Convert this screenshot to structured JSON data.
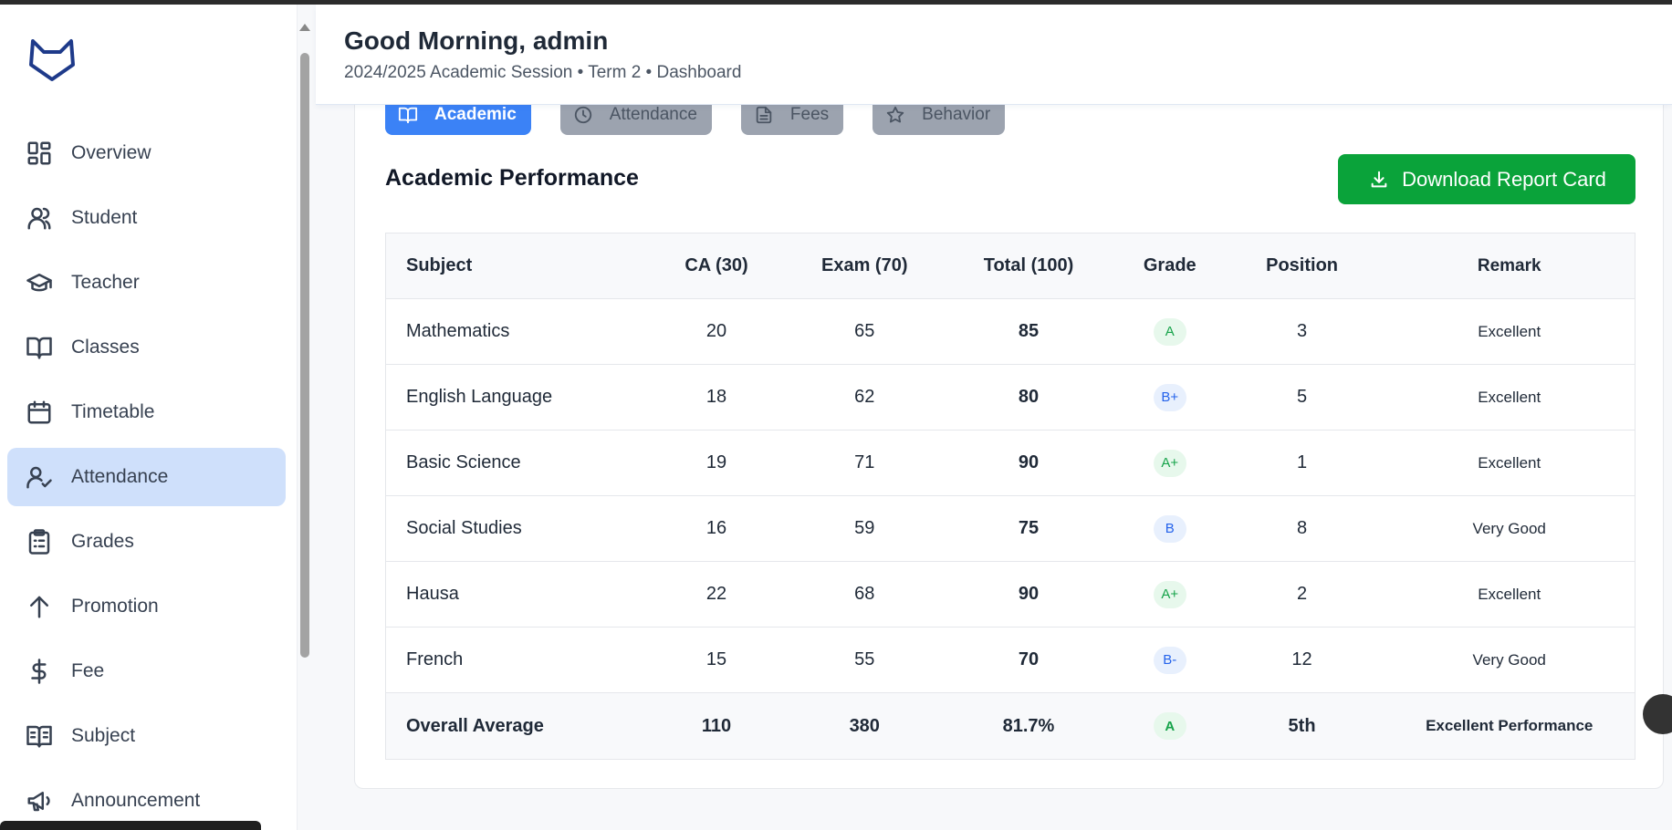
{
  "colors": {
    "accent": "#3b82f6",
    "active_nav_bg": "#cfe0fb",
    "download_green": "#0aa33a",
    "grade_green": "#16a34a",
    "grade_blue": "#2563eb"
  },
  "header": {
    "greeting": "Good Morning, admin",
    "subtitle": "2024/2025 Academic Session • Term 2 • Dashboard"
  },
  "sidebar": {
    "items": [
      {
        "label": "Overview",
        "icon": "grid-icon"
      },
      {
        "label": "Student",
        "icon": "users-icon"
      },
      {
        "label": "Teacher",
        "icon": "graduation-cap-icon"
      },
      {
        "label": "Classes",
        "icon": "book-open-icon"
      },
      {
        "label": "Timetable",
        "icon": "calendar-icon"
      },
      {
        "label": "Attendance",
        "icon": "user-check-icon",
        "active": true
      },
      {
        "label": "Grades",
        "icon": "clipboard-list-icon"
      },
      {
        "label": "Promotion",
        "icon": "arrow-up-icon"
      },
      {
        "label": "Fee",
        "icon": "dollar-icon"
      },
      {
        "label": "Subject",
        "icon": "book-text-icon"
      },
      {
        "label": "Announcement",
        "icon": "megaphone-icon"
      }
    ]
  },
  "tabs": [
    {
      "label": "Academic",
      "icon": "book-open-icon",
      "active": true
    },
    {
      "label": "Attendance",
      "icon": "clock-icon"
    },
    {
      "label": "Fees",
      "icon": "file-text-icon"
    },
    {
      "label": "Behavior",
      "icon": "star-icon"
    }
  ],
  "section": {
    "title": "Academic Performance",
    "download_label": "Download Report Card"
  },
  "table": {
    "headers": [
      "Subject",
      "CA (30)",
      "Exam (70)",
      "Total (100)",
      "Grade",
      "Position",
      "Remark"
    ],
    "rows": [
      {
        "subject": "Mathematics",
        "ca": "20",
        "exam": "65",
        "total": "85",
        "grade": "A",
        "position": "3",
        "remark": "Excellent"
      },
      {
        "subject": "English Language",
        "ca": "18",
        "exam": "62",
        "total": "80",
        "grade": "B+",
        "position": "5",
        "remark": "Excellent"
      },
      {
        "subject": "Basic Science",
        "ca": "19",
        "exam": "71",
        "total": "90",
        "grade": "A+",
        "position": "1",
        "remark": "Excellent"
      },
      {
        "subject": "Social Studies",
        "ca": "16",
        "exam": "59",
        "total": "75",
        "grade": "B",
        "position": "8",
        "remark": "Very Good"
      },
      {
        "subject": "Hausa",
        "ca": "22",
        "exam": "68",
        "total": "90",
        "grade": "A+",
        "position": "2",
        "remark": "Excellent"
      },
      {
        "subject": "French",
        "ca": "15",
        "exam": "55",
        "total": "70",
        "grade": "B-",
        "position": "12",
        "remark": "Very Good"
      }
    ],
    "footer": {
      "subject": "Overall Average",
      "ca": "110",
      "exam": "380",
      "total": "81.7%",
      "grade": "A",
      "position": "5th",
      "remark": "Excellent Performance"
    }
  }
}
